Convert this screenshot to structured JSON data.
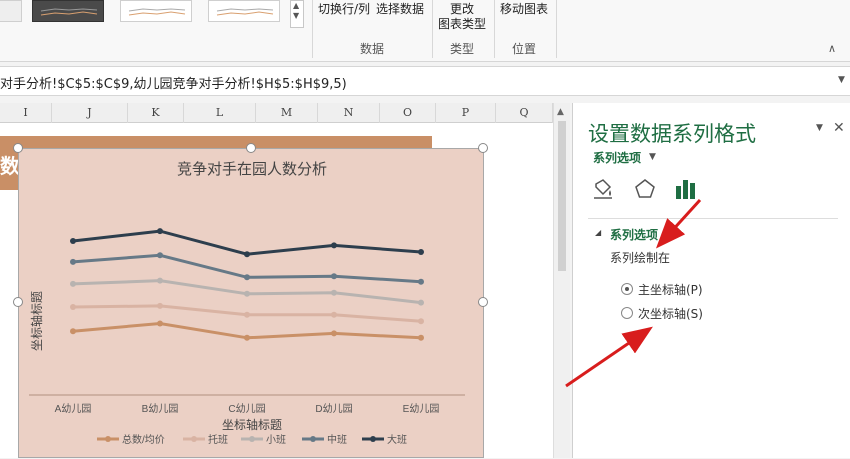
{
  "ribbon": {
    "switch_row_col": "切换行/列",
    "select_data": "选择数据",
    "change_type_line1": "更改",
    "change_type_line2": "图表类型",
    "move_chart": "移动图表",
    "group_data": "数据",
    "group_type": "类型",
    "group_location": "位置",
    "collapse_icon": "chevron-up-icon"
  },
  "formula_bar": {
    "text": "对手分析!$C$5:$C$9,幼儿园竞争对手分析!$H$5:$H$9,5)"
  },
  "sheet": {
    "columns": [
      "I",
      "J",
      "K",
      "L",
      "M",
      "N",
      "O",
      "P",
      "Q"
    ],
    "cell_fragment": "数"
  },
  "chart": {
    "title": "竞争对手在园人数分析",
    "background": "#ebd0c5"
  },
  "chart_data": {
    "type": "line",
    "title": "竞争对手在园人数分析",
    "xlabel": "坐标轴标题",
    "ylabel": "坐标轴标题",
    "categories": [
      "A幼儿园",
      "B幼儿园",
      "C幼儿园",
      "D幼儿园",
      "E幼儿园"
    ],
    "series": [
      {
        "name": "总数/均价",
        "color": "#c99067",
        "values": [
          58,
          65,
          52,
          56,
          52
        ]
      },
      {
        "name": "托班",
        "color": "#d9b3a3",
        "values": [
          80,
          81,
          73,
          73,
          67
        ]
      },
      {
        "name": "小班",
        "color": "#b8b3b0",
        "values": [
          101,
          104,
          92,
          93,
          84
        ]
      },
      {
        "name": "中班",
        "color": "#667987",
        "values": [
          121,
          127,
          107,
          108,
          103
        ]
      },
      {
        "name": "大班",
        "color": "#2d3e4d",
        "values": [
          140,
          149,
          128,
          136,
          130
        ]
      }
    ],
    "ylim": [
      0,
      200
    ],
    "grid": false,
    "legend": "bottom"
  },
  "pane": {
    "title": "设置数据系列格式",
    "subtitle": "系列选项",
    "section_title": "系列选项",
    "plot_on_label": "系列绘制在",
    "primary_axis": "主坐标轴(P)",
    "secondary_axis": "次坐标轴(S)",
    "selected": "primary",
    "accent_color": "#1f6e43"
  }
}
